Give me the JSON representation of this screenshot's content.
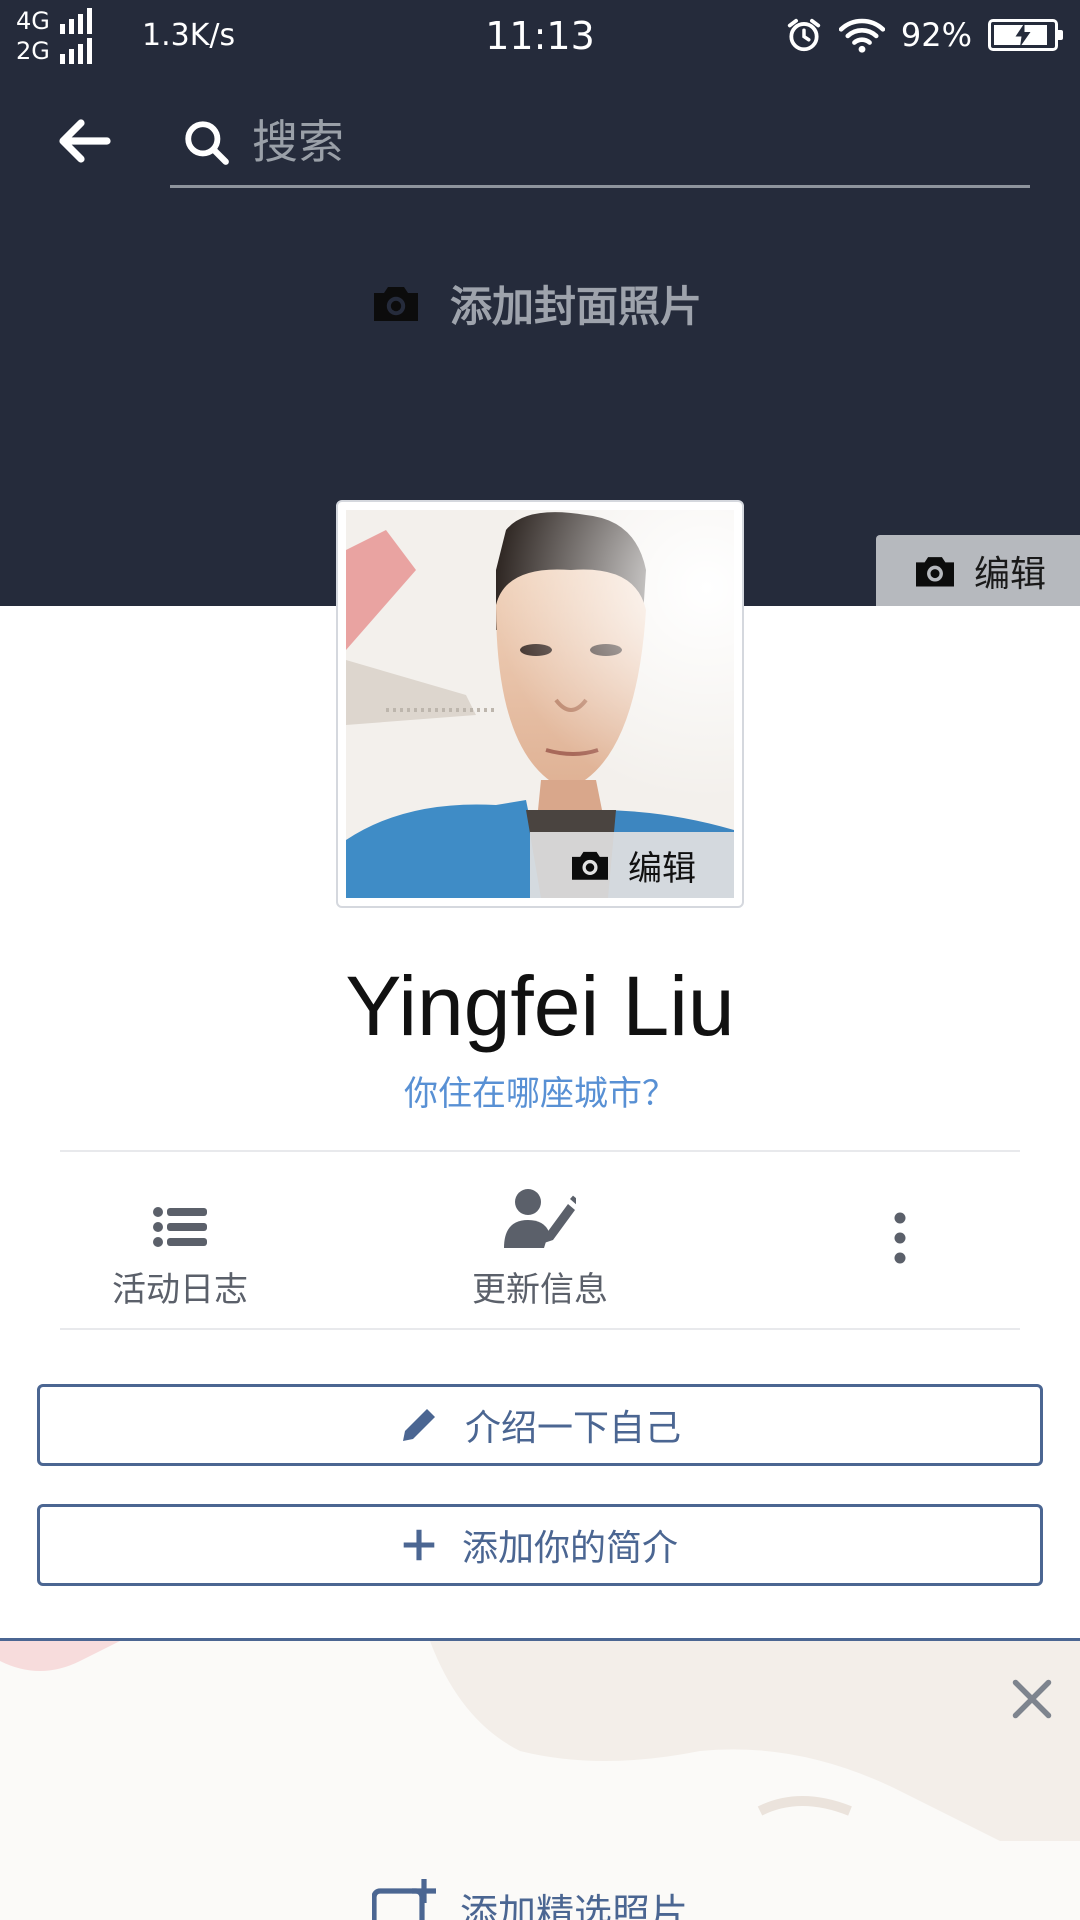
{
  "status_bar": {
    "network_top": "4G",
    "network_bottom": "2G",
    "speed": "1.3K/s",
    "time": "11:13",
    "battery": "92%",
    "battery_level": 0.92
  },
  "header": {
    "search_placeholder": "搜索"
  },
  "cover": {
    "add_cover_label": "添加封面照片",
    "edit_label": "编辑"
  },
  "profile": {
    "picture_edit_label": "编辑",
    "name": "Yingfei Liu",
    "city_prompt": "你住在哪座城市？"
  },
  "actions": [
    {
      "label": "活动日志",
      "icon": "list-icon"
    },
    {
      "label": "更新信息",
      "icon": "edit-profile-icon"
    },
    {
      "label": "",
      "icon": "more-vertical-icon"
    }
  ],
  "buttons": {
    "intro_label": "介绍一下自己",
    "bio_label": "添加你的简介"
  },
  "featured": {
    "add_label": "添加精选照片"
  },
  "colors": {
    "cover_bg": "#252b3b",
    "accent_blue": "#4b6692",
    "link_blue": "#5890d4",
    "icon_gray": "#5b606a"
  }
}
